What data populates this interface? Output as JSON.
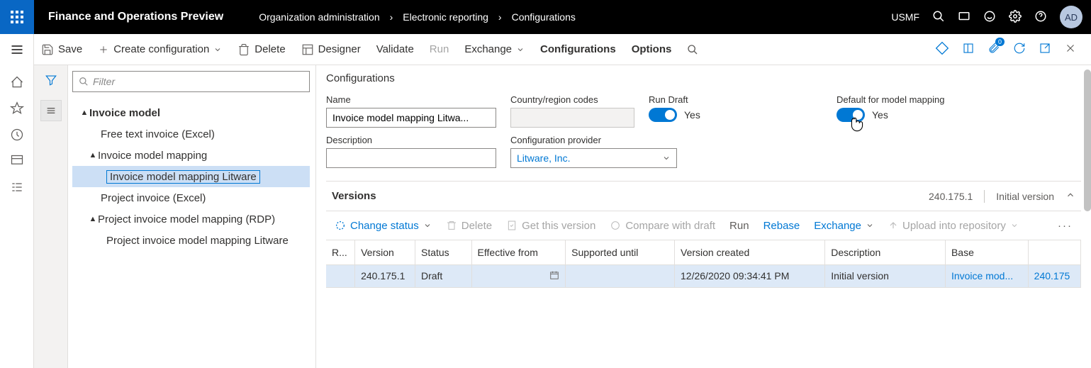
{
  "topbar": {
    "app_title": "Finance and Operations Preview",
    "breadcrumb": [
      "Organization administration",
      "Electronic reporting",
      "Configurations"
    ],
    "company": "USMF",
    "avatar": "AD"
  },
  "cmdbar": {
    "save": "Save",
    "create": "Create configuration",
    "delete": "Delete",
    "designer": "Designer",
    "validate": "Validate",
    "run": "Run",
    "exchange": "Exchange",
    "configurations": "Configurations",
    "options": "Options",
    "attach_badge": "0"
  },
  "filter": {
    "placeholder": "Filter"
  },
  "tree": {
    "n0": "Invoice model",
    "n1": "Free text invoice (Excel)",
    "n2": "Invoice model mapping",
    "n3": "Invoice model mapping Litware",
    "n4": "Project invoice (Excel)",
    "n5": "Project invoice model mapping (RDP)",
    "n6": "Project invoice model mapping Litware"
  },
  "detail": {
    "section": "Configurations",
    "name_label": "Name",
    "name_value": "Invoice model mapping Litwa...",
    "crc_label": "Country/region codes",
    "crc_value": "",
    "rundraft_label": "Run Draft",
    "rundraft_value": "Yes",
    "defaultmm_label": "Default for model mapping",
    "defaultmm_value": "Yes",
    "desc_label": "Description",
    "desc_value": "",
    "provider_label": "Configuration provider",
    "provider_value": "Litware, Inc."
  },
  "versions": {
    "title": "Versions",
    "summary_version": "240.175.1",
    "summary_desc": "Initial version",
    "actions": {
      "change_status": "Change status",
      "delete": "Delete",
      "get": "Get this version",
      "compare": "Compare with draft",
      "run": "Run",
      "rebase": "Rebase",
      "exchange": "Exchange",
      "upload": "Upload into repository"
    },
    "columns": {
      "r": "R...",
      "version": "Version",
      "status": "Status",
      "effective": "Effective from",
      "supported": "Supported until",
      "created": "Version created",
      "description": "Description",
      "base": "Base",
      "basever": ""
    },
    "row": {
      "version": "240.175.1",
      "status": "Draft",
      "effective": "",
      "supported": "",
      "created": "12/26/2020 09:34:41 PM",
      "description": "Initial version",
      "base": "Invoice mod...",
      "basever": "240.175"
    }
  }
}
